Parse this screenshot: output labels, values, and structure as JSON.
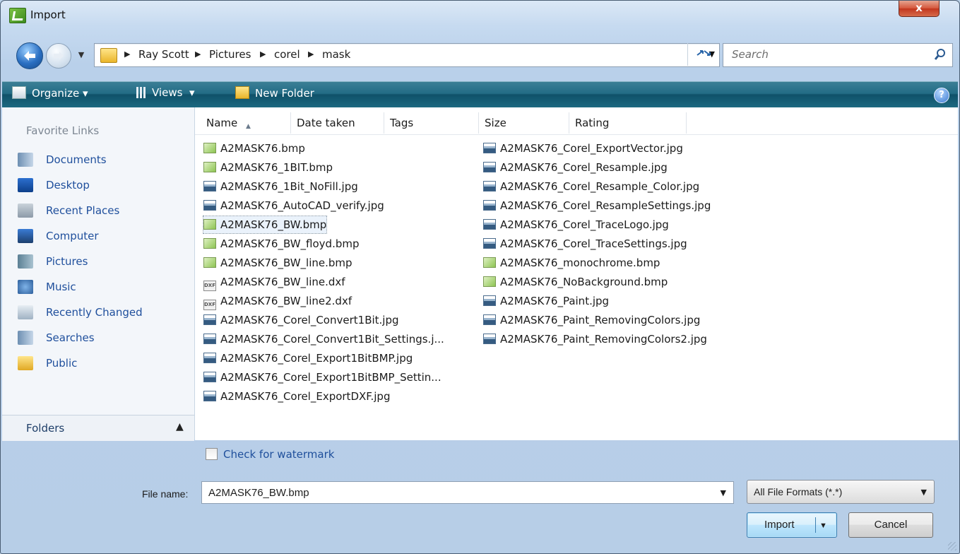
{
  "window": {
    "title": "Import",
    "close_label": "x"
  },
  "address": {
    "crumbs": [
      "Ray Scott",
      "Pictures",
      "corel",
      "mask"
    ],
    "search_placeholder": "Search"
  },
  "toolbar": {
    "organize": "Organize",
    "views": "Views",
    "new_folder": "New Folder",
    "help": "?"
  },
  "sidebar": {
    "heading": "Favorite Links",
    "links": [
      {
        "label": "Documents",
        "icon": "documents-icon"
      },
      {
        "label": "Desktop",
        "icon": "desktop-icon"
      },
      {
        "label": "Recent Places",
        "icon": "recent-places-icon"
      },
      {
        "label": "Computer",
        "icon": "computer-icon"
      },
      {
        "label": "Pictures",
        "icon": "pictures-icon"
      },
      {
        "label": "Music",
        "icon": "music-icon"
      },
      {
        "label": "Recently Changed",
        "icon": "recently-changed-icon"
      },
      {
        "label": "Searches",
        "icon": "searches-icon"
      },
      {
        "label": "Public",
        "icon": "public-folder-icon"
      }
    ],
    "folders_label": "Folders"
  },
  "columns": [
    "Name",
    "Date taken",
    "Tags",
    "Size",
    "Rating"
  ],
  "files": [
    {
      "name": "A2MASK76.bmp",
      "type": "bmp"
    },
    {
      "name": "A2MASK76_1BIT.bmp",
      "type": "bmp"
    },
    {
      "name": "A2MASK76_1Bit_NoFill.jpg",
      "type": "jpg"
    },
    {
      "name": "A2MASK76_AutoCAD_verify.jpg",
      "type": "jpg"
    },
    {
      "name": "A2MASK76_BW.bmp",
      "type": "bmp",
      "selected": true
    },
    {
      "name": "A2MASK76_BW_floyd.bmp",
      "type": "bmp"
    },
    {
      "name": "A2MASK76_BW_line.bmp",
      "type": "bmp"
    },
    {
      "name": "A2MASK76_BW_line.dxf",
      "type": "dxf"
    },
    {
      "name": "A2MASK76_BW_line2.dxf",
      "type": "dxf"
    },
    {
      "name": "A2MASK76_Corel_Convert1Bit.jpg",
      "type": "jpg"
    },
    {
      "name": "A2MASK76_Corel_Convert1Bit_Settings.j...",
      "type": "jpg"
    },
    {
      "name": "A2MASK76_Corel_Export1BitBMP.jpg",
      "type": "jpg"
    },
    {
      "name": "A2MASK76_Corel_Export1BitBMP_Settin...",
      "type": "jpg"
    },
    {
      "name": "A2MASK76_Corel_ExportDXF.jpg",
      "type": "jpg"
    },
    {
      "name": "A2MASK76_Corel_ExportVector.jpg",
      "type": "jpg"
    },
    {
      "name": "A2MASK76_Corel_Resample.jpg",
      "type": "jpg"
    },
    {
      "name": "A2MASK76_Corel_Resample_Color.jpg",
      "type": "jpg"
    },
    {
      "name": "A2MASK76_Corel_ResampleSettings.jpg",
      "type": "jpg"
    },
    {
      "name": "A2MASK76_Corel_TraceLogo.jpg",
      "type": "jpg"
    },
    {
      "name": "A2MASK76_Corel_TraceSettings.jpg",
      "type": "jpg"
    },
    {
      "name": "A2MASK76_monochrome.bmp",
      "type": "bmp"
    },
    {
      "name": "A2MASK76_NoBackground.bmp",
      "type": "bmp"
    },
    {
      "name": "A2MASK76_Paint.jpg",
      "type": "jpg"
    },
    {
      "name": "A2MASK76_Paint_RemovingColors.jpg",
      "type": "jpg"
    },
    {
      "name": "A2MASK76_Paint_RemovingColors2.jpg",
      "type": "jpg"
    }
  ],
  "options": {
    "watermark_label": "Check for watermark",
    "watermark_checked": false
  },
  "footer": {
    "filename_label": "File name:",
    "filename_value": "A2MASK76_BW.bmp",
    "filter_value": "All File Formats (*.*)",
    "import_label": "Import",
    "cancel_label": "Cancel"
  }
}
